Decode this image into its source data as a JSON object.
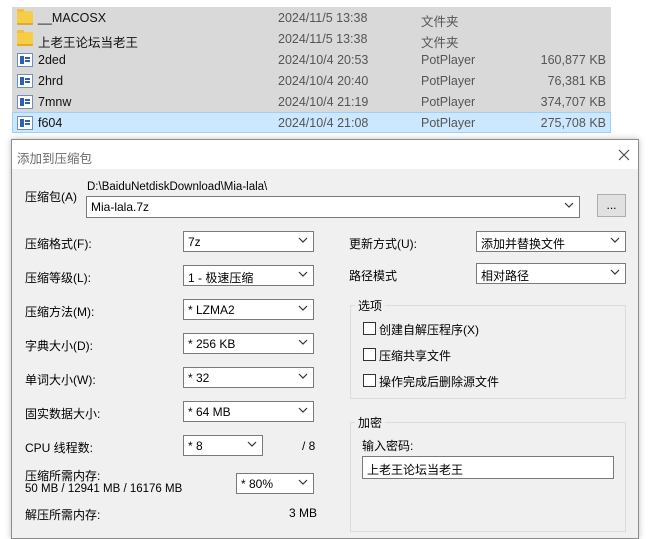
{
  "files": [
    {
      "name": "__MACOSX",
      "date": "2024/11/5 13:38",
      "type": "文件夹",
      "size": "",
      "icon": "folder-icon",
      "selected": false
    },
    {
      "name": "上老王论坛当老王",
      "date": "2024/11/5 13:38",
      "type": "文件夹",
      "size": "",
      "icon": "folder-icon",
      "selected": false
    },
    {
      "name": "2ded",
      "date": "2024/10/4 20:53",
      "type": "PotPlayer",
      "size": "160,877 KB",
      "icon": "video-file-icon",
      "selected": false
    },
    {
      "name": "2hrd",
      "date": "2024/10/4 20:40",
      "type": "PotPlayer",
      "size": "76,381 KB",
      "icon": "video-file-icon",
      "selected": false
    },
    {
      "name": "7mnw",
      "date": "2024/10/4 21:19",
      "type": "PotPlayer",
      "size": "374,707 KB",
      "icon": "video-file-icon",
      "selected": false
    },
    {
      "name": "f604",
      "date": "2024/10/4 21:08",
      "type": "PotPlayer",
      "size": "275,708 KB",
      "icon": "video-file-icon",
      "selected": true
    }
  ],
  "dialog": {
    "title": "添加到压缩包",
    "archive": {
      "label": "压缩包(A)",
      "path": "D:\\BaiduNetdiskDownload\\Mia-lala\\",
      "value": "Mia-lala.7z",
      "browse_label": "..."
    },
    "format": {
      "label": "压缩格式(F):",
      "value": "7z"
    },
    "level": {
      "label": "压缩等级(L):",
      "value": "1 - 极速压缩"
    },
    "method": {
      "label": "压缩方法(M):",
      "value": "* LZMA2"
    },
    "dict": {
      "label": "字典大小(D):",
      "value": "* 256 KB"
    },
    "word": {
      "label": "单词大小(W):",
      "value": "* 32"
    },
    "solid": {
      "label": "固实数据大小:",
      "value": "* 64 MB"
    },
    "cpu": {
      "label": "CPU 线程数:",
      "value": "* 8",
      "max": "/ 8"
    },
    "mem_comp": {
      "label": "压缩所需内存:",
      "detail": "50 MB / 12941 MB / 16176 MB",
      "value": "* 80%"
    },
    "mem_decomp": {
      "label": "解压所需内存:",
      "value": "3 MB"
    },
    "update": {
      "label": "更新方式(U):",
      "value": "添加并替换文件"
    },
    "pathmode": {
      "label": "路径模式",
      "value": "相对路径"
    },
    "options": {
      "title": "选项",
      "sfx": "创建自解压程序(X)",
      "shared": "压缩共享文件",
      "delete": "操作完成后删除源文件"
    },
    "encryption": {
      "title": "加密",
      "password_label": "输入密码:",
      "password_value": "上老王论坛当老王"
    }
  },
  "colors": {
    "row_bg": "#d9d9d9",
    "row_selected_bg": "#cce8ff",
    "dialog_bg": "#f0f0f0"
  }
}
